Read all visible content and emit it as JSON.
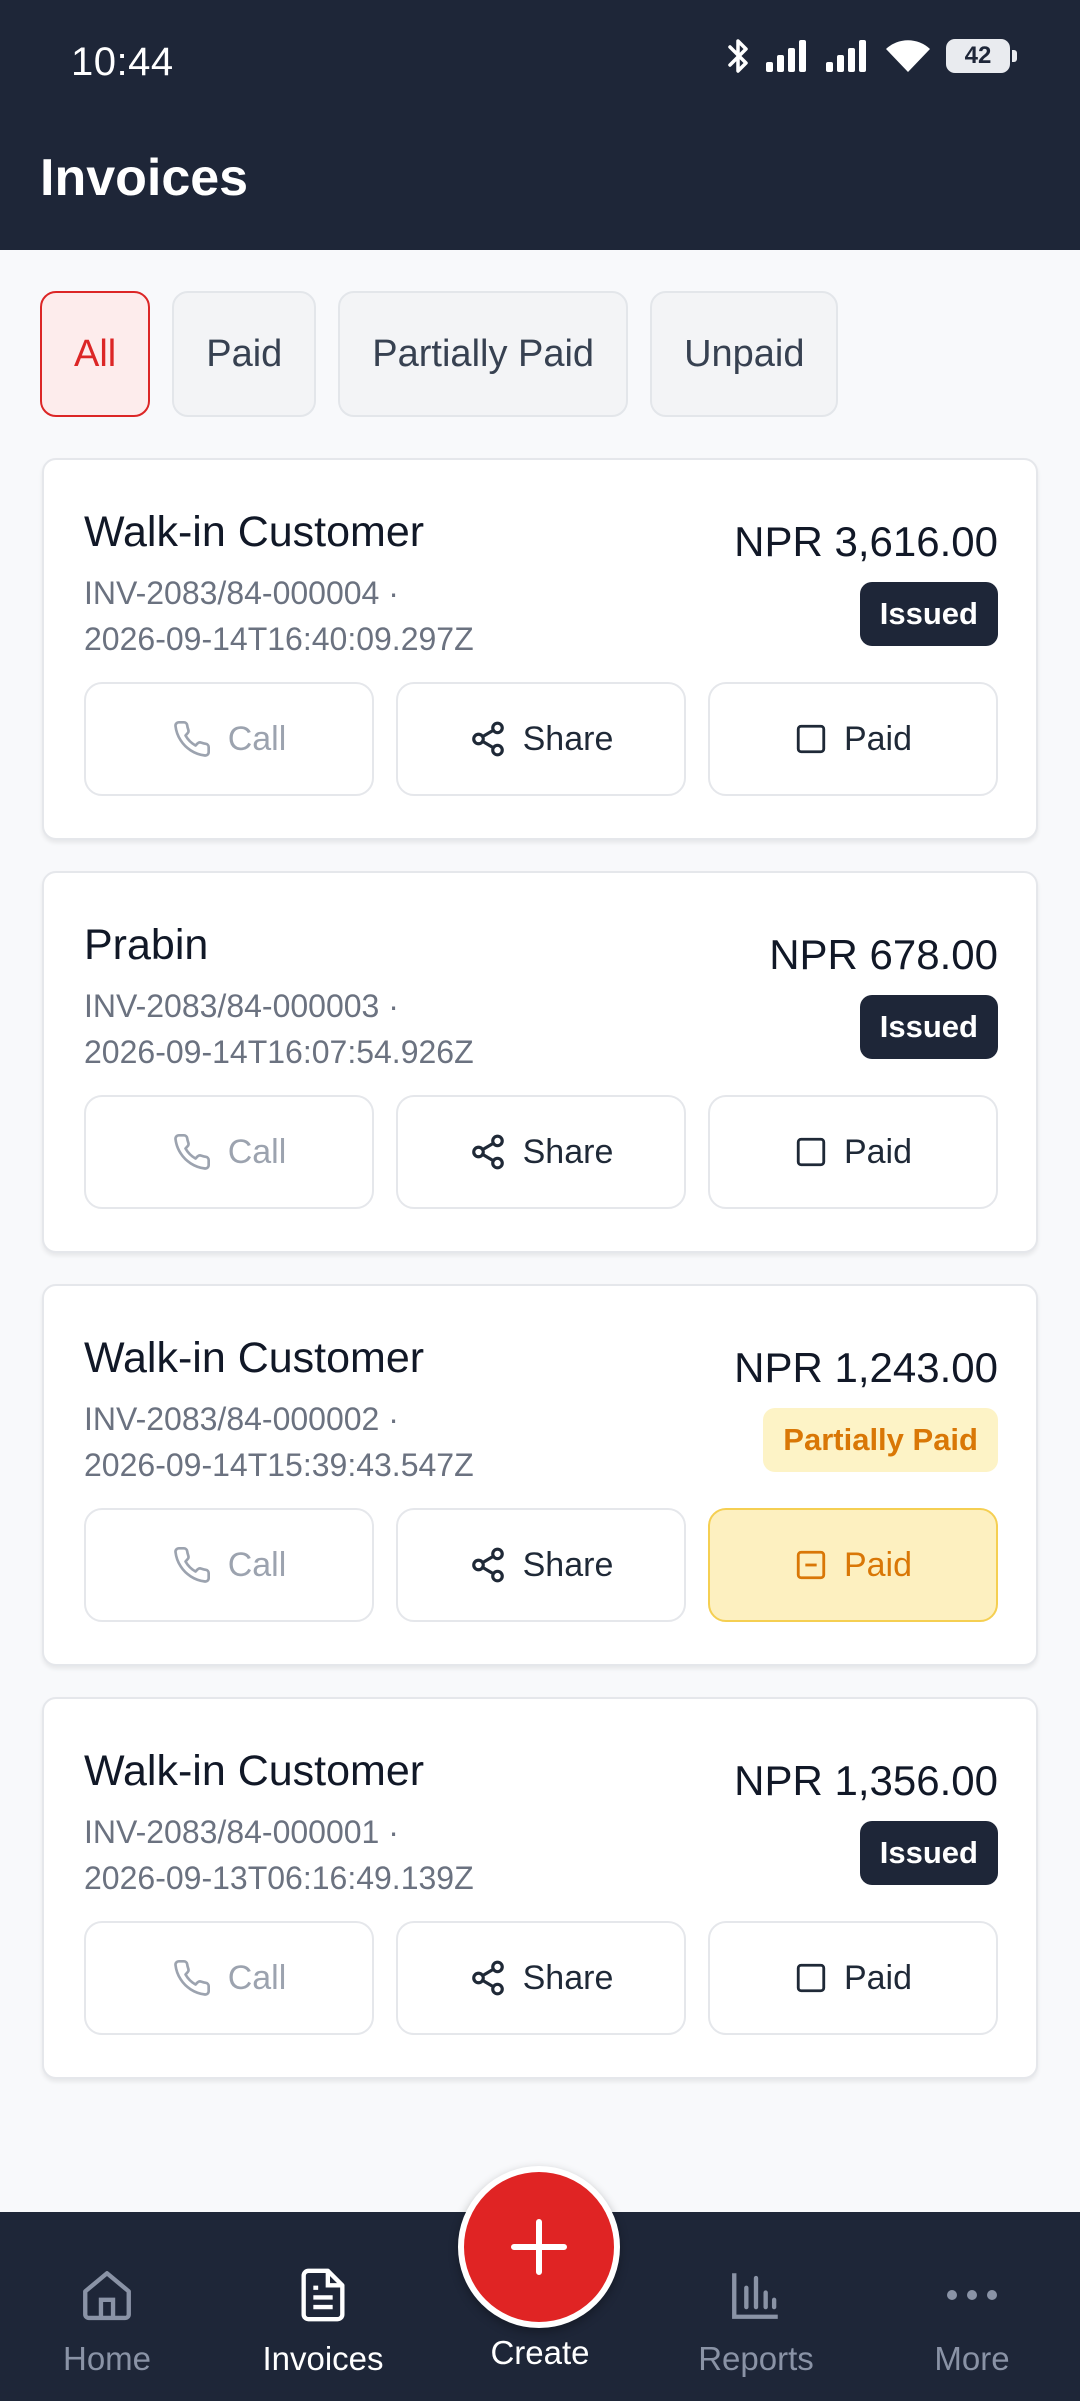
{
  "status_bar": {
    "time": "10:44",
    "battery": "42"
  },
  "header": {
    "title": "Invoices"
  },
  "filters": [
    {
      "label": "All",
      "active": true
    },
    {
      "label": "Paid",
      "active": false
    },
    {
      "label": "Partially Paid",
      "active": false
    },
    {
      "label": "Unpaid",
      "active": false
    }
  ],
  "invoices": [
    {
      "customer": "Walk-in Customer",
      "number": "INV-2083/84-000004 ·",
      "timestamp": "2026-09-14T16:40:09.297Z",
      "amount": "NPR 3,616.00",
      "status": "Issued",
      "call_label": "Call",
      "share_label": "Share",
      "paid_label": "Paid"
    },
    {
      "customer": "Prabin",
      "number": "INV-2083/84-000003 ·",
      "timestamp": "2026-09-14T16:07:54.926Z",
      "amount": "NPR 678.00",
      "status": "Issued",
      "call_label": "Call",
      "share_label": "Share",
      "paid_label": "Paid"
    },
    {
      "customer": "Walk-in Customer",
      "number": "INV-2083/84-000002 ·",
      "timestamp": "2026-09-14T15:39:43.547Z",
      "amount": "NPR 1,243.00",
      "status": "Partially Paid",
      "call_label": "Call",
      "share_label": "Share",
      "paid_label": "Paid"
    },
    {
      "customer": "Walk-in Customer",
      "number": "INV-2083/84-000001 ·",
      "timestamp": "2026-09-13T06:16:49.139Z",
      "amount": "NPR 1,356.00",
      "status": "Issued",
      "call_label": "Call",
      "share_label": "Share",
      "paid_label": "Paid"
    }
  ],
  "bottom_nav": {
    "home": "Home",
    "invoices": "Invoices",
    "create": "Create",
    "reports": "Reports",
    "more": "More",
    "active": "invoices"
  },
  "colors": {
    "header_bg": "#1e2638",
    "accent_red": "#dc2626",
    "partial_amber": "#d97706",
    "partial_bg": "#fdf0c0"
  }
}
